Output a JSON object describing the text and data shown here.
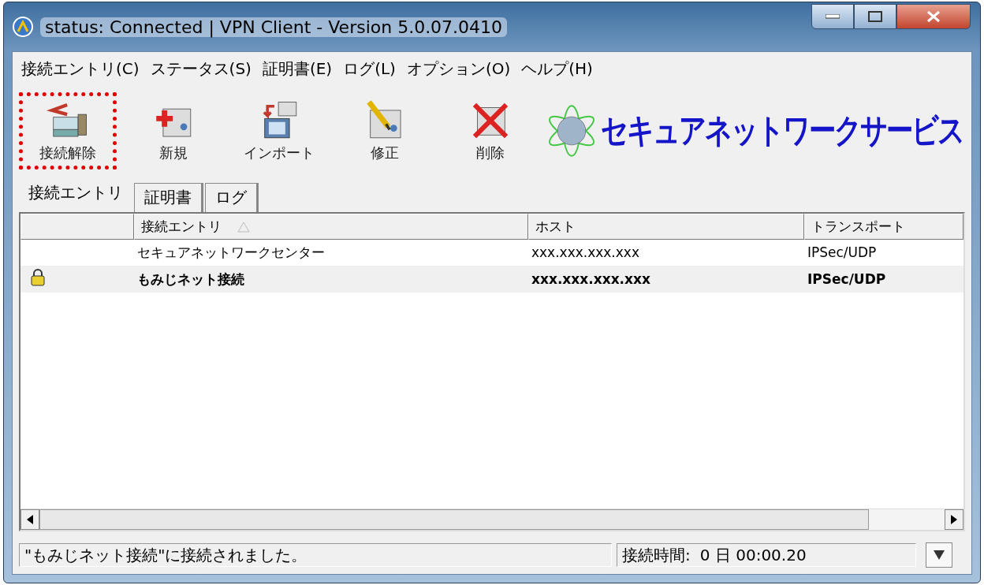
{
  "window": {
    "title": "status: Connected | VPN Client - Version 5.0.07.0410"
  },
  "menu": [
    {
      "label": "接続エントリ(C)"
    },
    {
      "label": "ステータス(S)"
    },
    {
      "label": "証明書(E)"
    },
    {
      "label": "ログ(L)"
    },
    {
      "label": "オプション(O)"
    },
    {
      "label": "ヘルプ(H)"
    }
  ],
  "toolbar": [
    {
      "kind": "disconnect",
      "label": "接続解除",
      "highlighted": true
    },
    {
      "kind": "new",
      "label": "新規",
      "highlighted": false
    },
    {
      "kind": "import",
      "label": "インポート",
      "highlighted": false
    },
    {
      "kind": "edit",
      "label": "修正",
      "highlighted": false
    },
    {
      "kind": "delete",
      "label": "削除",
      "highlighted": false
    }
  ],
  "logo": {
    "text": "セキュアネットワークサービス"
  },
  "tabs": [
    {
      "label": "接続エントリ",
      "selected": true
    },
    {
      "label": "証明書",
      "selected": false
    },
    {
      "label": "ログ",
      "selected": false
    }
  ],
  "table": {
    "columns": [
      "接続エントリ",
      "ホスト",
      "トランスポート"
    ],
    "rows": [
      {
        "connected": false,
        "cells": [
          "セキュアネットワークセンター",
          "xxx.xxx.xxx.xxx",
          "IPSec/UDP"
        ]
      },
      {
        "connected": true,
        "cells": [
          "もみじネット接続",
          "xxx.xxx.xxx.xxx",
          "IPSec/UDP"
        ]
      }
    ]
  },
  "status_bar": {
    "message": "\"もみじネット接続\"に接続されました。",
    "time_label": "接続時間:",
    "time_value": "0 日 00:00.20"
  }
}
